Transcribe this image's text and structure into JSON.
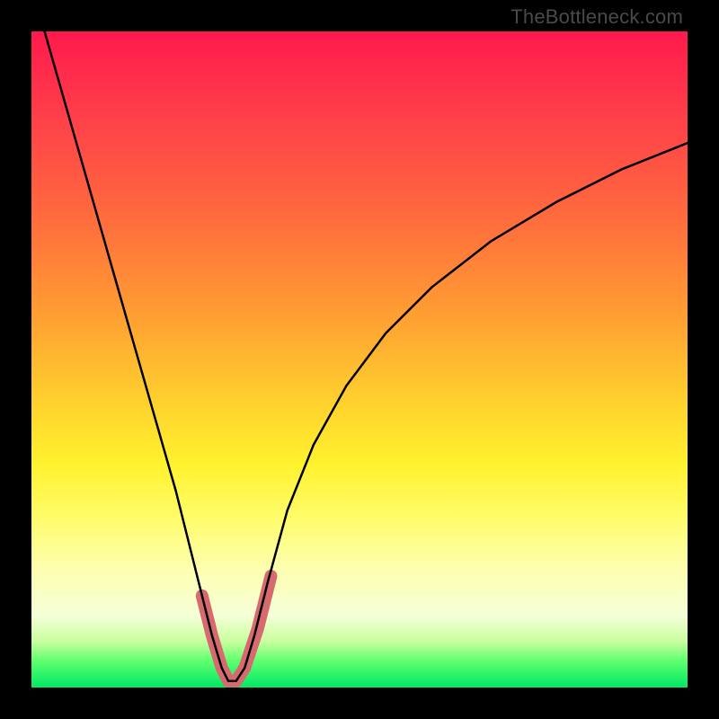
{
  "watermark": "TheBottleneck.com",
  "chart_data": {
    "type": "line",
    "title": "",
    "xlabel": "",
    "ylabel": "",
    "xlim": [
      0,
      1
    ],
    "ylim": [
      0,
      1
    ],
    "grid": false,
    "legend": false,
    "series": [
      {
        "name": "black-curve",
        "color": "#000000",
        "stroke_width": 2.5,
        "x": [
          0.02,
          0.06,
          0.1,
          0.14,
          0.18,
          0.22,
          0.255,
          0.275,
          0.29,
          0.3,
          0.312,
          0.325,
          0.34,
          0.36,
          0.39,
          0.43,
          0.48,
          0.54,
          0.61,
          0.7,
          0.8,
          0.9,
          1.0
        ],
        "y": [
          1.0,
          0.86,
          0.72,
          0.58,
          0.44,
          0.3,
          0.16,
          0.08,
          0.03,
          0.01,
          0.01,
          0.03,
          0.08,
          0.16,
          0.27,
          0.37,
          0.46,
          0.54,
          0.61,
          0.68,
          0.74,
          0.79,
          0.83
        ]
      },
      {
        "name": "red-accent-segment",
        "color": "#d66a6e",
        "stroke_width": 14,
        "x": [
          0.26,
          0.275,
          0.29,
          0.3,
          0.312,
          0.325,
          0.345,
          0.365
        ],
        "y": [
          0.14,
          0.08,
          0.03,
          0.01,
          0.01,
          0.03,
          0.09,
          0.17
        ]
      }
    ]
  }
}
